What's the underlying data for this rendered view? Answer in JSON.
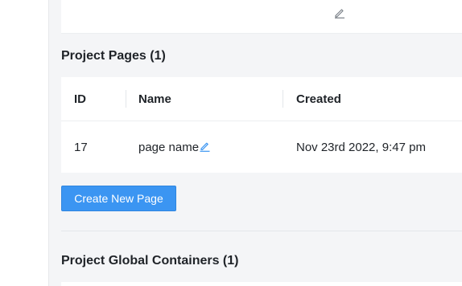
{
  "top_card": {
    "edit_icon": "pencil-icon"
  },
  "pages_section": {
    "title": "Project Pages (1)",
    "columns": [
      "ID",
      "Name",
      "Created"
    ],
    "rows": [
      {
        "id": "17",
        "name": "page name",
        "created": "Nov 23rd 2022, 9:47 pm",
        "edit_icon": "pencil-icon"
      }
    ],
    "create_button": "Create New Page"
  },
  "containers_section": {
    "title": "Project Global Containers (1)"
  },
  "colors": {
    "accent": "#3b95f2",
    "link": "#3b95f2",
    "background": "#f4f5f7",
    "card": "#ffffff"
  }
}
